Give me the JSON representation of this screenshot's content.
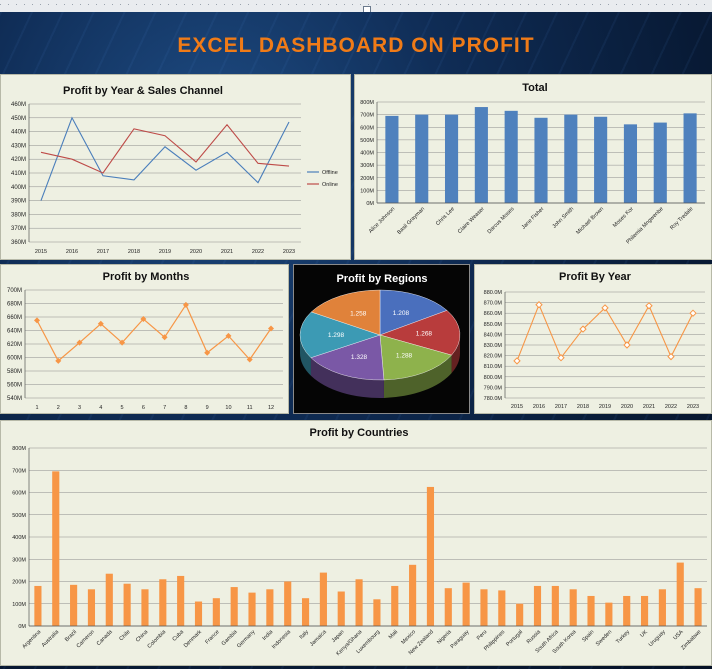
{
  "header": {
    "title": "EXCEL DASHBOARD ON PROFIT"
  },
  "colors": {
    "offline": "#4a7ebb",
    "online": "#be4b48",
    "bar": "#4f81bd",
    "orange": "#f79646",
    "title": "#f07b17"
  },
  "chart_data": [
    {
      "id": "year_channel",
      "type": "line",
      "title": "Profit by Year & Sales Channel",
      "x": [
        "2015",
        "2016",
        "2017",
        "2018",
        "2019",
        "2020",
        "2021",
        "2022",
        "2023"
      ],
      "ylim": [
        360,
        460
      ],
      "yticks": [
        "360M",
        "370M",
        "380M",
        "390M",
        "400M",
        "410M",
        "420M",
        "430M",
        "440M",
        "450M",
        "460M"
      ],
      "series": [
        {
          "name": "Offline",
          "values": [
            390,
            450,
            408,
            405,
            429,
            412,
            425,
            403,
            447
          ]
        },
        {
          "name": "Online",
          "values": [
            425,
            420,
            410,
            442,
            437,
            418,
            445,
            417,
            415
          ]
        }
      ],
      "legend": "right"
    },
    {
      "id": "total",
      "type": "bar",
      "title": "Total",
      "categories": [
        "Alice Johnson",
        "Basil Grayman",
        "Chris Lee",
        "Claire Weaser",
        "Darcus Moses",
        "Jane Fisher",
        "John Smith",
        "Michael Brown",
        "Moses Kor",
        "Philemia Mngwenbe",
        "Roy Tredale"
      ],
      "values": [
        690,
        700,
        700,
        760,
        730,
        675,
        700,
        683,
        623,
        637,
        710
      ],
      "ylim": [
        0,
        800
      ],
      "yticks": [
        "0M",
        "100M",
        "200M",
        "300M",
        "400M",
        "500M",
        "600M",
        "700M",
        "800M"
      ]
    },
    {
      "id": "months",
      "type": "line",
      "title": "Profit by Months",
      "x": [
        "1",
        "2",
        "3",
        "4",
        "5",
        "6",
        "7",
        "8",
        "9",
        "10",
        "11",
        "12"
      ],
      "values": [
        655,
        595,
        622,
        650,
        622,
        657,
        630,
        678,
        607,
        632,
        597,
        643
      ],
      "ylim": [
        540,
        700
      ],
      "yticks": [
        "540M",
        "560M",
        "580M",
        "600M",
        "620M",
        "640M",
        "660M",
        "680M",
        "700M"
      ]
    },
    {
      "id": "regions",
      "type": "pie",
      "title": "Profit by Regions",
      "slices": [
        {
          "label": "1.208",
          "value": 1.208,
          "color": "#4a6fbd"
        },
        {
          "label": "1.268",
          "value": 1.268,
          "color": "#b83c3c"
        },
        {
          "label": "1.288",
          "value": 1.288,
          "color": "#8eb24c"
        },
        {
          "label": "1.328",
          "value": 1.328,
          "color": "#7a58a6"
        },
        {
          "label": "1.298",
          "value": 1.298,
          "color": "#3c9ab4"
        },
        {
          "label": "1.258",
          "value": 1.258,
          "color": "#e0823a"
        }
      ]
    },
    {
      "id": "by_year",
      "type": "line",
      "title": "Profit By Year",
      "x": [
        "2015",
        "2016",
        "2017",
        "2018",
        "2019",
        "2020",
        "2021",
        "2022",
        "2023"
      ],
      "values": [
        815,
        868,
        818,
        845,
        865,
        830,
        867,
        819,
        860
      ],
      "ylim": [
        780,
        880
      ],
      "yticks": [
        "780.0M",
        "790.0M",
        "800.0M",
        "810.0M",
        "820.0M",
        "830.0M",
        "840.0M",
        "850.0M",
        "860.0M",
        "870.0M",
        "880.0M"
      ]
    },
    {
      "id": "countries",
      "type": "bar",
      "title": "Profit  by Countries",
      "categories": [
        "Argentina",
        "Australia",
        "Brazil",
        "Cameron",
        "Canada",
        "Chile",
        "China",
        "Colombia",
        "Cuba",
        "Denmark",
        "France",
        "Gambia",
        "Germany",
        "India",
        "Indonesia",
        "Italy",
        "Jamaica",
        "Japan",
        "Kenya/Ghana",
        "Luxembourg",
        "Mali",
        "Mexico",
        "New Zealand",
        "Nigeria",
        "Paraguay",
        "Peru",
        "Philippines",
        "Portugal",
        "Russia",
        "South Africa",
        "South Korea",
        "Spain",
        "Sweden",
        "Turkey",
        "UK",
        "Uruguay",
        "USA",
        "Zimbabwe"
      ],
      "values": [
        180,
        695,
        185,
        165,
        235,
        190,
        165,
        210,
        225,
        110,
        125,
        175,
        150,
        165,
        200,
        125,
        240,
        155,
        210,
        120,
        180,
        275,
        625,
        170,
        195,
        165,
        160,
        100,
        180,
        180,
        165,
        135,
        105,
        135,
        135,
        165,
        285,
        170
      ],
      "ylim": [
        0,
        800
      ],
      "yticks": [
        "0M",
        "100M",
        "200M",
        "300M",
        "400M",
        "500M",
        "600M",
        "700M",
        "800M"
      ]
    }
  ]
}
